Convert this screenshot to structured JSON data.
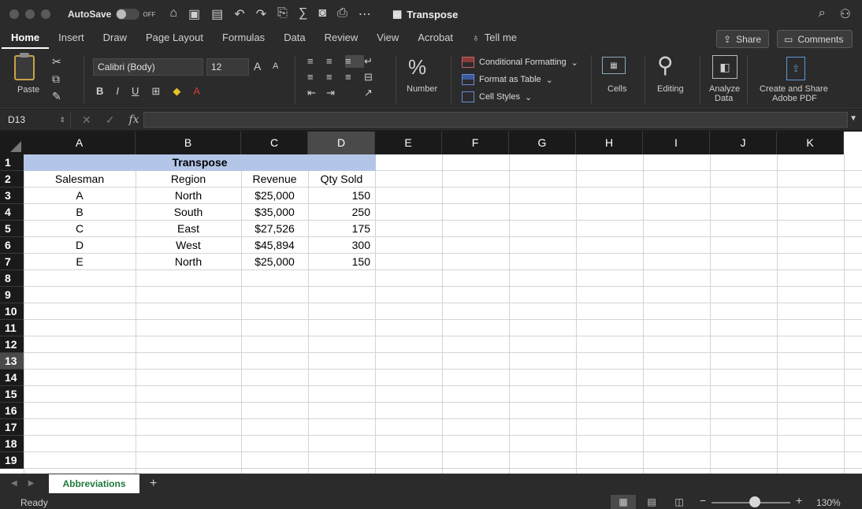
{
  "window": {
    "autosave_label": "AutoSave",
    "autosave_state": "OFF",
    "title": "Transpose"
  },
  "ribbon_tabs": [
    "Home",
    "Insert",
    "Draw",
    "Page Layout",
    "Formulas",
    "Data",
    "Review",
    "View",
    "Acrobat"
  ],
  "tell_me": "Tell me",
  "share_label": "Share",
  "comments_label": "Comments",
  "ribbon": {
    "paste_label": "Paste",
    "font_name": "Calibri (Body)",
    "font_size": "12",
    "number_label": "Number",
    "conditional_formatting": "Conditional Formatting",
    "format_as_table": "Format as Table",
    "cell_styles": "Cell Styles",
    "cells_label": "Cells",
    "editing_label": "Editing",
    "analyze_label_1": "Analyze",
    "analyze_label_2": "Data",
    "create_share_1": "Create and Share",
    "create_share_2": "Adobe PDF"
  },
  "formula_bar": {
    "name_box": "D13",
    "formula": ""
  },
  "sheet": {
    "columns": [
      "A",
      "B",
      "C",
      "D",
      "E",
      "F",
      "G",
      "H",
      "I",
      "J",
      "K"
    ],
    "selected_column": "D",
    "selected_row": "13",
    "rows": [
      "1",
      "2",
      "3",
      "4",
      "5",
      "6",
      "7",
      "8",
      "9",
      "10",
      "11",
      "12",
      "13",
      "14",
      "15",
      "16",
      "17",
      "18",
      "19"
    ],
    "title": "Transpose",
    "headers": [
      "Salesman",
      "Region",
      "Revenue",
      "Qty Sold"
    ],
    "data": [
      [
        "A",
        "North",
        "$25,000",
        "150"
      ],
      [
        "B",
        "South",
        "$35,000",
        "250"
      ],
      [
        "C",
        "East",
        "$27,526",
        "175"
      ],
      [
        "D",
        "West",
        "$45,894",
        "300"
      ],
      [
        "E",
        "North",
        "$25,000",
        "150"
      ]
    ]
  },
  "sheet_tabs": {
    "active": "Abbreviations"
  },
  "status": {
    "text": "Ready",
    "zoom": "130%"
  }
}
